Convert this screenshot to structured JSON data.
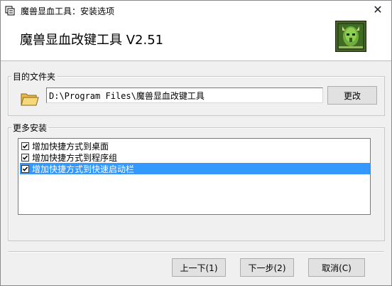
{
  "window": {
    "title": "魔兽显血工具：安装选项",
    "close_symbol": "✕",
    "icons": {
      "app": "installer-icon",
      "close": "close-icon"
    }
  },
  "header": {
    "title": "魔兽显血改键工具 V2.51",
    "logo": "warcraft-face-logo"
  },
  "destination": {
    "legend": "目的文件夹",
    "path": "D:\\Program Files\\魔兽显血改键工具",
    "change_label": "更改",
    "folder_icon": "folder-icon"
  },
  "more_install": {
    "legend": "更多安装",
    "items": [
      {
        "label": "增加快捷方式到桌面",
        "checked": true,
        "selected": false
      },
      {
        "label": "增加快捷方式到程序组",
        "checked": true,
        "selected": false
      },
      {
        "label": "增加快捷方式到快速启动栏",
        "checked": true,
        "selected": true
      }
    ]
  },
  "buttons": {
    "back": "上一下(1)",
    "next": "下一步(2)",
    "cancel": "取消(C)"
  },
  "colors": {
    "selection": "#3399ff",
    "window_bg": "#f0f0f0",
    "header_bg": "#ffffff"
  }
}
